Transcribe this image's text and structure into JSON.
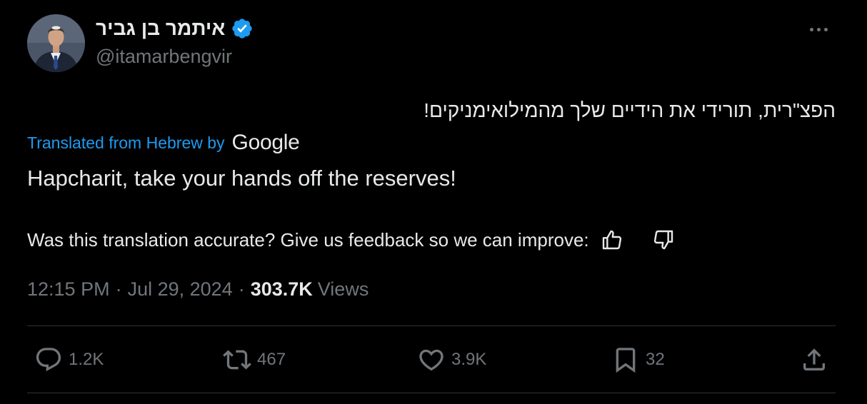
{
  "author": {
    "display_name": "איתמר בן גביר",
    "handle": "@itamarbengvir",
    "verified": true
  },
  "tweet": {
    "original_text": "הפצ\"רית, תורידי את הידיים שלך מהמילואימניקים!",
    "translated_from_label": "Translated from Hebrew by",
    "translation_provider": "Google",
    "translation": "Hapcharit, take your hands off the reserves!",
    "feedback_prompt": "Was this translation accurate? Give us feedback so we can improve:"
  },
  "meta": {
    "time": "12:15 PM",
    "separator": "·",
    "date": "Jul 29, 2024",
    "views_count": "303.7K",
    "views_label": "Views"
  },
  "actions": {
    "replies": "1.2K",
    "reposts": "467",
    "likes": "3.9K",
    "bookmarks": "32"
  },
  "colors": {
    "background": "#000000",
    "text": "#e7e9ea",
    "secondary": "#71767b",
    "accent": "#1d9bf0",
    "divider": "#2f3336"
  }
}
